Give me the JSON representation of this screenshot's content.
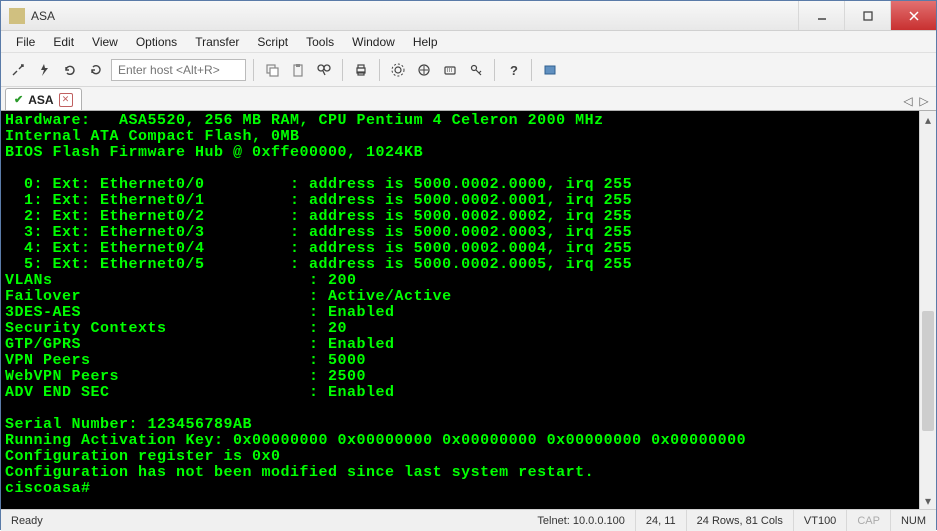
{
  "window": {
    "title": "ASA"
  },
  "menus": [
    "File",
    "Edit",
    "View",
    "Options",
    "Transfer",
    "Script",
    "Tools",
    "Window",
    "Help"
  ],
  "toolbar": {
    "host_placeholder": "Enter host <Alt+R>"
  },
  "tab": {
    "label": "ASA"
  },
  "terminal_lines": [
    "Hardware:   ASA5520, 256 MB RAM, CPU Pentium 4 Celeron 2000 MHz",
    "Internal ATA Compact Flash, 0MB",
    "BIOS Flash Firmware Hub @ 0xffe00000, 1024KB",
    "",
    "  0: Ext: Ethernet0/0         : address is 5000.0002.0000, irq 255",
    "  1: Ext: Ethernet0/1         : address is 5000.0002.0001, irq 255",
    "  2: Ext: Ethernet0/2         : address is 5000.0002.0002, irq 255",
    "  3: Ext: Ethernet0/3         : address is 5000.0002.0003, irq 255",
    "  4: Ext: Ethernet0/4         : address is 5000.0002.0004, irq 255",
    "  5: Ext: Ethernet0/5         : address is 5000.0002.0005, irq 255",
    "VLANs                           : 200",
    "Failover                        : Active/Active",
    "3DES-AES                        : Enabled",
    "Security Contexts               : 20",
    "GTP/GPRS                        : Enabled",
    "VPN Peers                       : 5000",
    "WebVPN Peers                    : 2500",
    "ADV END SEC                     : Enabled",
    "",
    "Serial Number: 123456789AB",
    "Running Activation Key: 0x00000000 0x00000000 0x00000000 0x00000000 0x00000000",
    "Configuration register is 0x0",
    "Configuration has not been modified since last system restart.",
    "ciscoasa#"
  ],
  "status": {
    "ready": "Ready",
    "conn": "Telnet: 10.0.0.100",
    "pos": "24,  11",
    "size": "24 Rows, 81 Cols",
    "emu": "VT100",
    "cap": "CAP",
    "num": "NUM"
  }
}
